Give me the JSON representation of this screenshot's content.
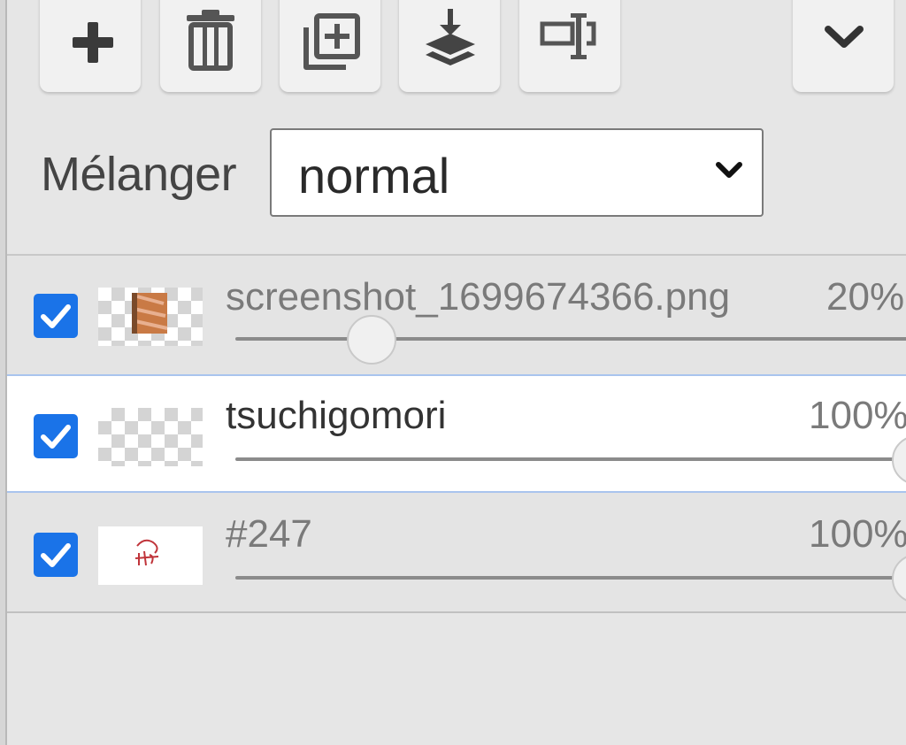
{
  "toolbar": {
    "buttons": [
      {
        "name": "add-layer",
        "icon": "plus-icon"
      },
      {
        "name": "delete-layer",
        "icon": "trash-icon"
      },
      {
        "name": "duplicate-layer",
        "icon": "duplicate-icon"
      },
      {
        "name": "merge-down",
        "icon": "merge-down-icon"
      },
      {
        "name": "rename-layer",
        "icon": "rename-icon"
      }
    ],
    "menu_icon": "chevron-down-icon"
  },
  "blend": {
    "label": "Mélanger",
    "value": "normal"
  },
  "layers": [
    {
      "name": "screenshot_1699674366.png",
      "opacity": "20%",
      "opacity_value": 0.2,
      "visible": true,
      "selected": false,
      "thumbnail": "image-thumbnail"
    },
    {
      "name": "tsuchigomori",
      "opacity": "100%",
      "opacity_value": 1.0,
      "visible": true,
      "selected": true,
      "thumbnail": "transparent-thumbnail"
    },
    {
      "name": "#247",
      "opacity": "100%",
      "opacity_value": 1.0,
      "visible": true,
      "selected": false,
      "thumbnail": "sketch-thumbnail"
    }
  ],
  "colors": {
    "accent": "#1a73e8",
    "selected_border": "#a9c4ee",
    "panel_bg": "#e6e6e6"
  }
}
